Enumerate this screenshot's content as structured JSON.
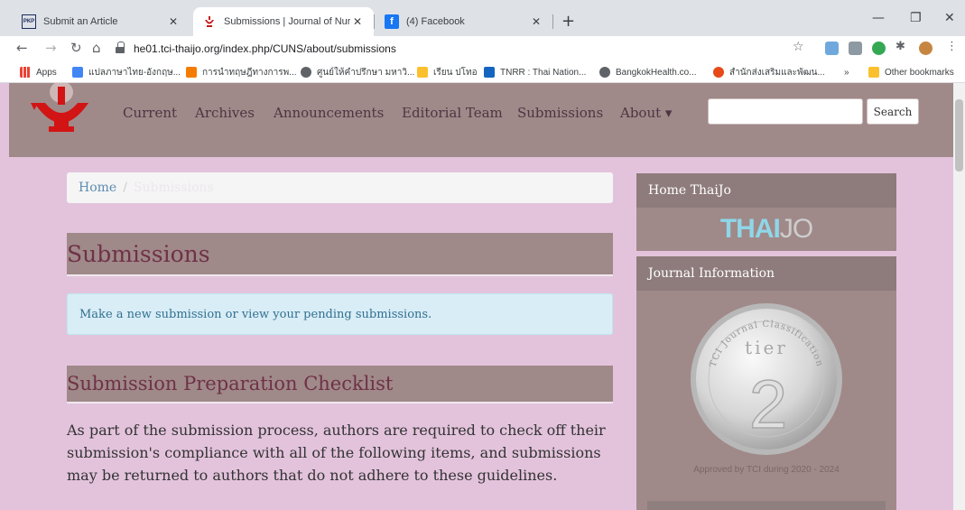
{
  "browser": {
    "tabs": [
      {
        "label": "Submit an Article",
        "favicon": "PKP",
        "active": false
      },
      {
        "label": "Submissions | Journal of Nursing",
        "favicon": "journal-logo",
        "active": true
      },
      {
        "label": "(4) Facebook",
        "favicon": "f",
        "active": false
      }
    ],
    "new_tab": "+",
    "url": "he01.tci-thaijo.org/index.php/CUNS/about/submissions",
    "bookmarks": [
      {
        "label": "Apps",
        "color": "#ea4335"
      },
      {
        "label": "แปลภาษาไทย-อังกฤษ...",
        "color": "#4285f4"
      },
      {
        "label": "การนำทฤษฎีทางการพ...",
        "color": "#f57c00"
      },
      {
        "label": "ศูนย์ให้คำปรึกษา มหาวิ...",
        "color": "#5f6368"
      },
      {
        "label": "เรียน ปโทอ",
        "color": "#fbc02d"
      },
      {
        "label": "TNRR : Thai Nation...",
        "color": "#1565c0"
      },
      {
        "label": "BangkokHealth.co...",
        "color": "#5f6368"
      },
      {
        "label": "สำนักส่งเสริมและพัฒน...",
        "color": "#e64a19"
      },
      {
        "label": "»",
        "color": ""
      },
      {
        "label": "Other bookmarks",
        "color": "#fbc02d"
      }
    ]
  },
  "header": {
    "nav": [
      "Current",
      "Archives",
      "Announcements",
      "Editorial Team",
      "Submissions",
      "About ▾"
    ],
    "search_button": "Search"
  },
  "main": {
    "breadcrumb_home": "Home",
    "breadcrumb_sep": "/",
    "breadcrumb_current": "Submissions",
    "title": "Submissions",
    "alert": "Make a new submission or view your pending submissions.",
    "checklist_title": "Submission Preparation Checklist",
    "paragraph": "As part of the submission process, authors are required to check off their submission's compliance with all of the following items, and submissions may be returned to authors that do not adhere to these guidelines."
  },
  "sidebar": {
    "block1_title": "Home ThaiJo",
    "logo_part1": "THAI",
    "logo_part2": "JO",
    "block2_title": "Journal Information",
    "medal_arc_text": "TCI Journal Classification",
    "medal_label": "tier",
    "medal_number": "2",
    "approved_text": "Approved by TCI during 2020 - 2024"
  }
}
